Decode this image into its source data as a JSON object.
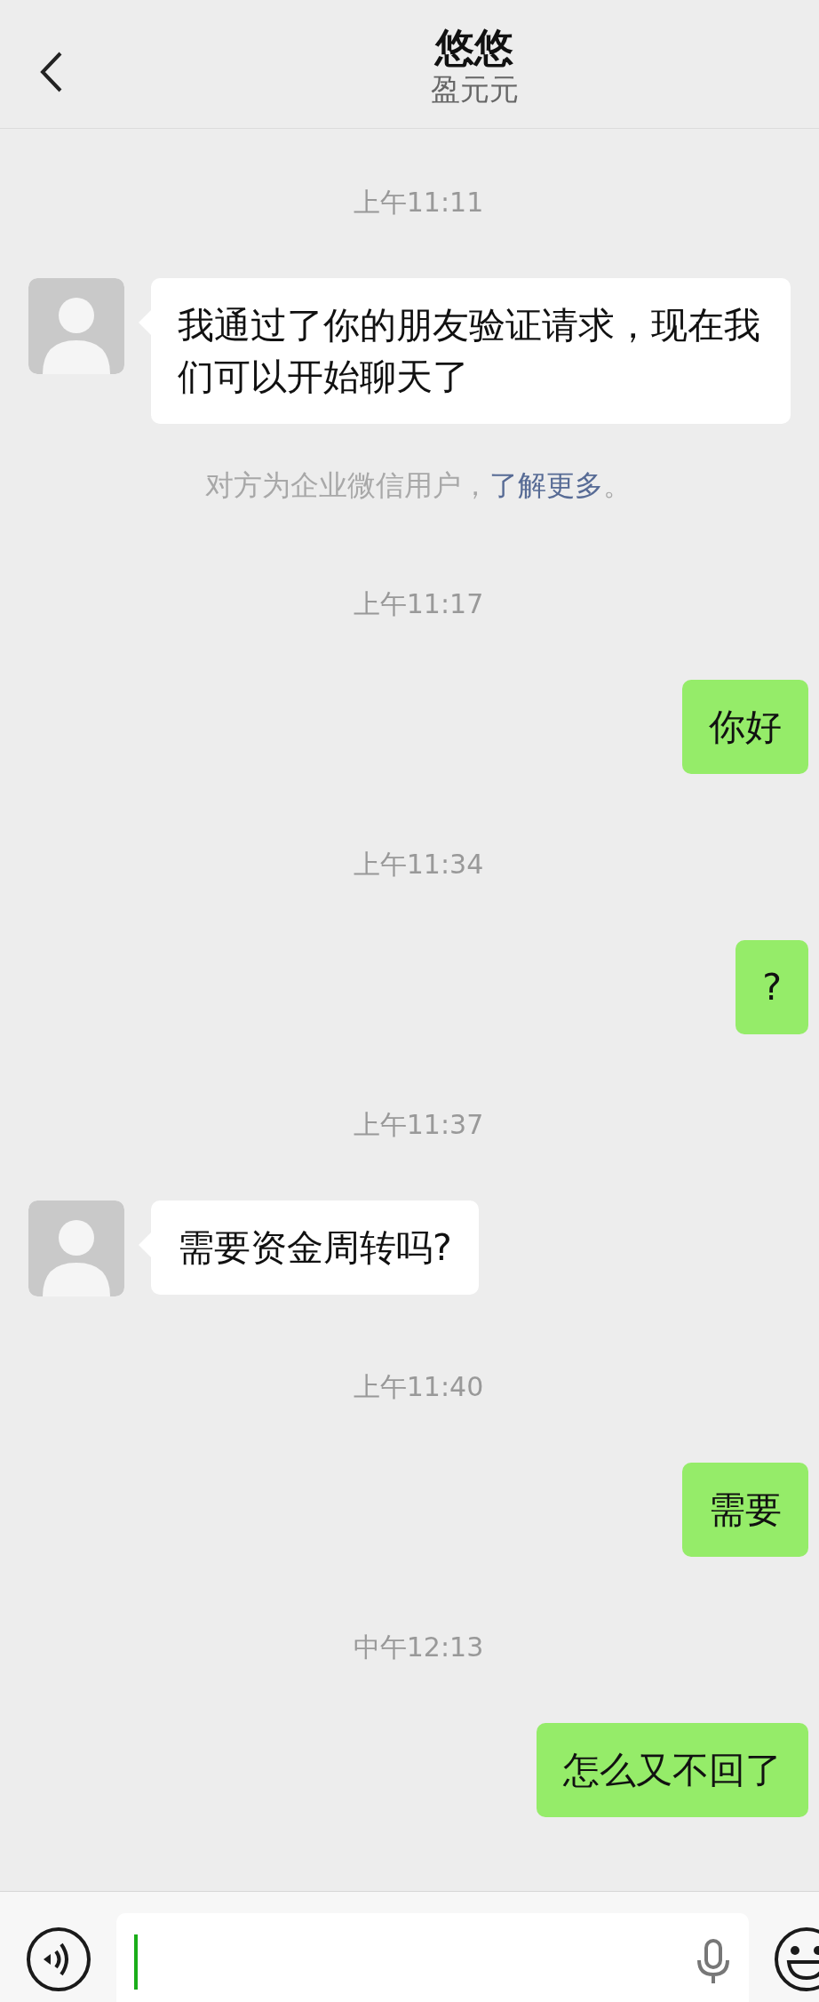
{
  "header": {
    "title": "悠悠",
    "subtitle": "盈元元"
  },
  "messages": [
    {
      "kind": "time",
      "text": "上午11:11"
    },
    {
      "kind": "incoming",
      "text": "我通过了你的朋友验证请求，现在我们可以开始聊天了"
    },
    {
      "kind": "notice",
      "text": "对方为企业微信用户，",
      "link": "了解更多",
      "after": "。"
    },
    {
      "kind": "time",
      "text": "上午11:17"
    },
    {
      "kind": "outgoing",
      "text": "你好"
    },
    {
      "kind": "time",
      "text": "上午11:34"
    },
    {
      "kind": "outgoing",
      "text": "?"
    },
    {
      "kind": "time",
      "text": "上午11:37"
    },
    {
      "kind": "incoming",
      "text": "需要资金周转吗?"
    },
    {
      "kind": "time",
      "text": "上午11:40"
    },
    {
      "kind": "outgoing",
      "text": "需要"
    },
    {
      "kind": "time",
      "text": "中午12:13"
    },
    {
      "kind": "outgoing",
      "text": "怎么又不回了"
    }
  ]
}
